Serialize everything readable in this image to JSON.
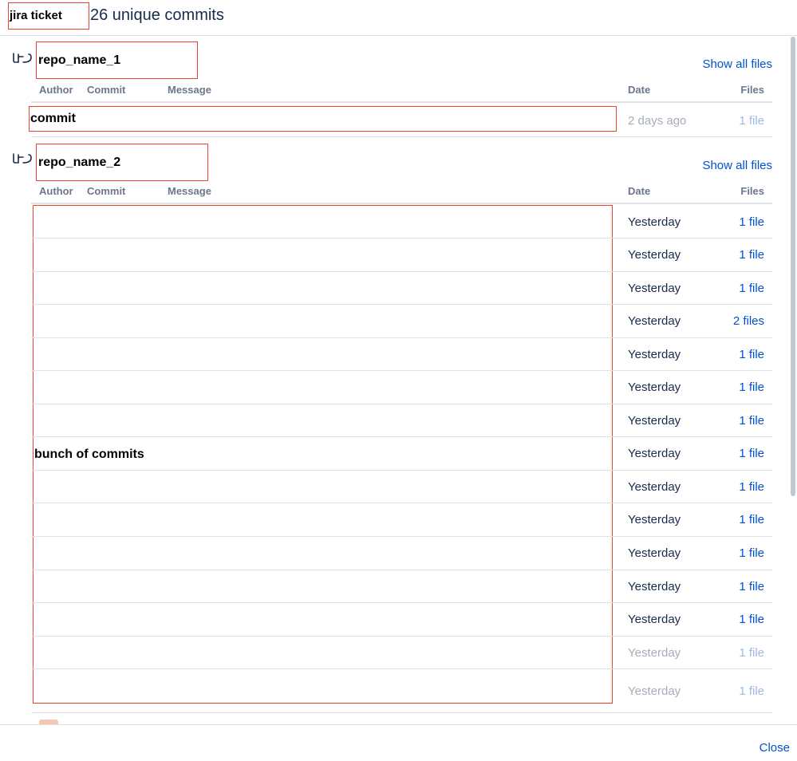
{
  "header": {
    "ticket_label": "jira ticket",
    "title": "26 unique commits"
  },
  "columns": {
    "author": "Author",
    "commit": "Commit",
    "message": "Message",
    "date": "Date",
    "files": "Files"
  },
  "repos": [
    {
      "name": "repo_name_1",
      "show_all": "Show all files",
      "placeholder": "commit",
      "commits": [
        {
          "date": "2 days ago",
          "files": "1 file",
          "faded": true
        }
      ]
    },
    {
      "name": "repo_name_2",
      "show_all": "Show all files",
      "placeholder": "bunch of commits",
      "commits": [
        {
          "date": "Yesterday",
          "files": "1 file",
          "faded": false
        },
        {
          "date": "Yesterday",
          "files": "1 file",
          "faded": false
        },
        {
          "date": "Yesterday",
          "files": "1 file",
          "faded": false
        },
        {
          "date": "Yesterday",
          "files": "2 files",
          "faded": false
        },
        {
          "date": "Yesterday",
          "files": "1 file",
          "faded": false
        },
        {
          "date": "Yesterday",
          "files": "1 file",
          "faded": false
        },
        {
          "date": "Yesterday",
          "files": "1 file",
          "faded": false
        },
        {
          "date": "Yesterday",
          "files": "1 file",
          "faded": false
        },
        {
          "date": "Yesterday",
          "files": "1 file",
          "faded": false
        },
        {
          "date": "Yesterday",
          "files": "1 file",
          "faded": false
        },
        {
          "date": "Yesterday",
          "files": "1 file",
          "faded": false
        },
        {
          "date": "Yesterday",
          "files": "1 file",
          "faded": false
        },
        {
          "date": "Yesterday",
          "files": "1 file",
          "faded": false
        },
        {
          "date": "Yesterday",
          "files": "1 file",
          "faded": true
        },
        {
          "date": "Yesterday",
          "files": "1 file",
          "faded": true
        }
      ]
    }
  ],
  "footer": {
    "close_label": "Close"
  },
  "icons": {
    "repo": "repository-icon"
  },
  "colors": {
    "link": "#0052cc",
    "text": "#172b4d",
    "muted": "#6b778c",
    "annotation": "#e8452c"
  }
}
